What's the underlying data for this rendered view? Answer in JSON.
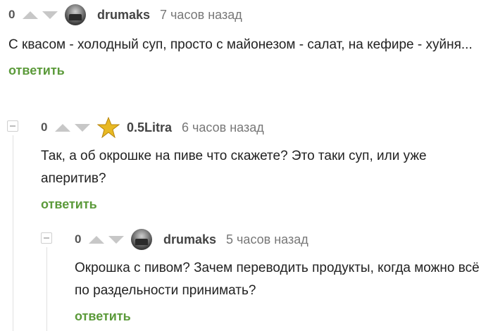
{
  "comments": [
    {
      "rating": "0",
      "author": "drumaks",
      "time": "7 часов назад",
      "text": "С квасом - холодный суп, просто с майонезом - салат, на кефире - хуйня...",
      "reply_label": "ответить",
      "avatar_icon": "avatar-photo"
    },
    {
      "rating": "0",
      "author": "0.5Litra",
      "time": "6 часов назад",
      "text": "Так, а об окрошке на пиве что скажете? Это таки суп, или уже аперитив?",
      "reply_label": "ответить",
      "avatar_icon": "star-icon"
    },
    {
      "rating": "0",
      "author": "drumaks",
      "time": "5 часов назад",
      "text": "Окрошка с пивом? Зачем переводить продукты, когда можно всё по раздельности принимать?",
      "reply_label": "ответить",
      "avatar_icon": "avatar-photo"
    }
  ],
  "colors": {
    "reply_link": "#5b9a3a",
    "arrow": "#c7c7c7",
    "star": "#e8b923"
  }
}
